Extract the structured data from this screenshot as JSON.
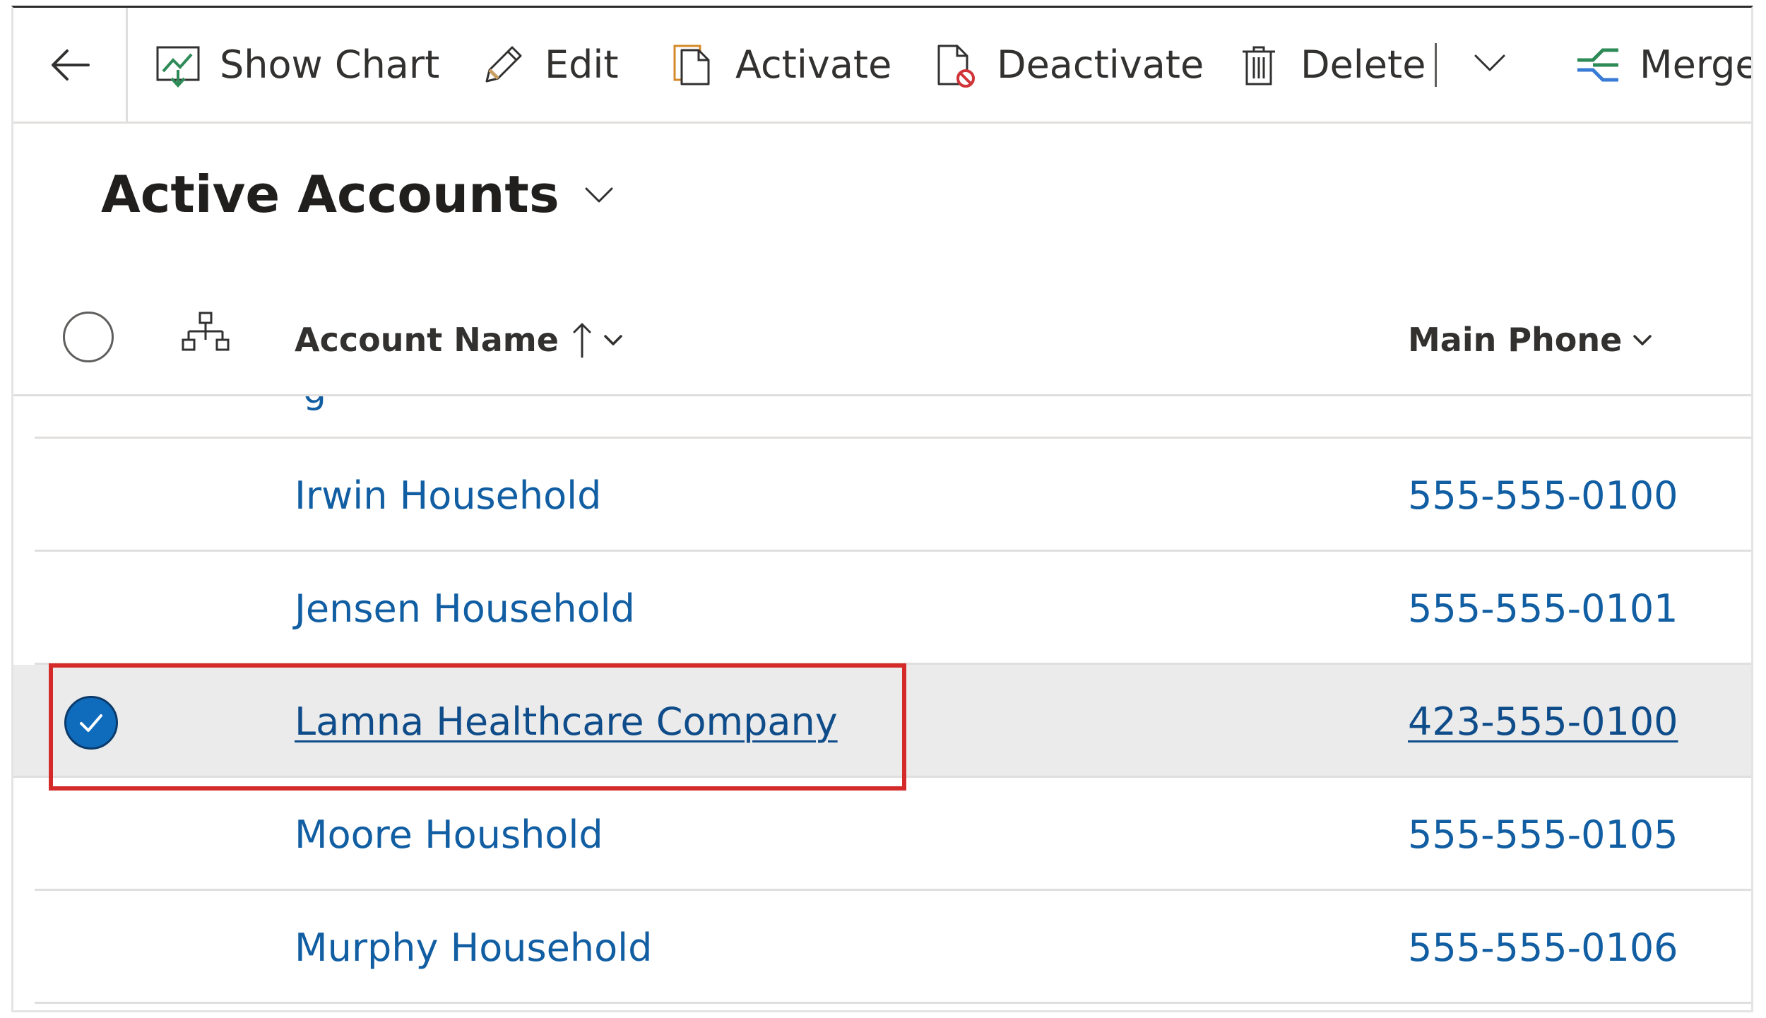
{
  "toolbar": {
    "show_chart": "Show Chart",
    "edit": "Edit",
    "activate": "Activate",
    "deactivate": "Deactivate",
    "delete": "Delete",
    "merge": "Merge"
  },
  "view": {
    "title": "Active Accounts"
  },
  "grid": {
    "columns": {
      "account_name": "Account Name",
      "main_phone": "Main Phone"
    },
    "sort": {
      "column": "Account Name",
      "direction": "ascending"
    },
    "rows": [
      {
        "name": "Irwin Household",
        "phone": "555-555-0100",
        "selected": false
      },
      {
        "name": "Jensen Household",
        "phone": "555-555-0101",
        "selected": false
      },
      {
        "name": "Lamna Healthcare Company",
        "phone": "423-555-0100",
        "selected": true
      },
      {
        "name": "Moore Houshold",
        "phone": "555-555-0105",
        "selected": false
      },
      {
        "name": "Murphy Household",
        "phone": "555-555-0106",
        "selected": false
      }
    ]
  },
  "colors": {
    "link": "#115ea3",
    "selected_row_bg": "#ebebeb",
    "check_fill": "#0f6cbd",
    "highlight_border": "#d42a2a"
  },
  "icons": [
    "back-arrow-icon",
    "show-chart-icon",
    "edit-pencil-icon",
    "activate-icon",
    "deactivate-icon",
    "delete-trash-icon",
    "chevron-down-icon",
    "merge-icon",
    "hierarchy-icon",
    "sort-ascending-icon",
    "checkmark-icon"
  ]
}
